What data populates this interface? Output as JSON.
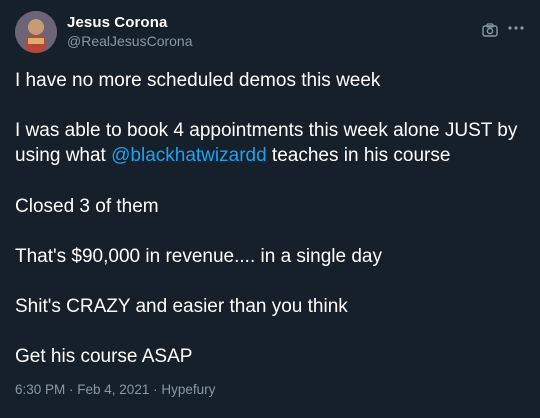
{
  "author": {
    "name": "Jesus Corona",
    "handle": "@RealJesusCorona"
  },
  "icons": {
    "camera": "camera-icon",
    "more": "more-options-icon"
  },
  "tweet": {
    "line1": "I have no more scheduled demos this week",
    "line2_before": "I was able to book 4 appointments this week alone JUST by using what ",
    "line2_mention": "@blackhatwizardd",
    "line2_after": " teaches in his course",
    "line3": "Closed 3 of them",
    "line4": "That's $90,000 in revenue.... in a single day",
    "line5": "Shit's CRAZY and easier than you think",
    "line6": "Get his course ASAP"
  },
  "meta": {
    "time": "6:30 PM",
    "separator1": " · ",
    "date": "Feb 4, 2021",
    "separator2": " · ",
    "source": "Hypefury"
  },
  "colors": {
    "background": "#15202b",
    "text": "#ffffff",
    "secondary": "#8899a6",
    "link": "#1da1f2"
  }
}
